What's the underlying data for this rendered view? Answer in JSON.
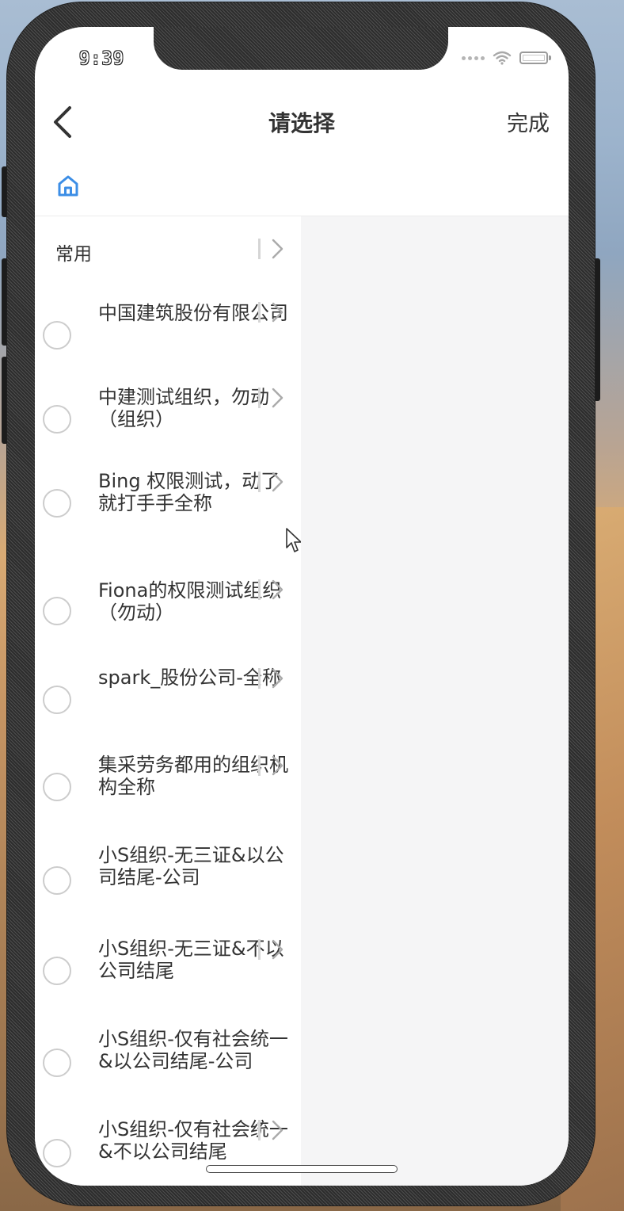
{
  "status_bar": {
    "time": "9:39",
    "icons": [
      "signal-dots-icon",
      "wifi-icon",
      "battery-icon"
    ]
  },
  "navbar": {
    "back_icon": "chevron-left-icon",
    "title": "请选择",
    "done_label": "完成"
  },
  "breadcrumb": {
    "home_icon": "home-icon",
    "accent_color": "#3c8ee6"
  },
  "common": {
    "label": "常用"
  },
  "org_list": [
    {
      "label": "中国建筑股份有限公司",
      "selected": false
    },
    {
      "label": "中建测试组织，勿动（组织）",
      "selected": false
    },
    {
      "label": "Bing 权限测试，动了就打手手全称",
      "selected": false
    },
    {
      "label": "Fiona的权限测试组织（勿动）",
      "selected": false
    },
    {
      "label": "spark_股份公司-全称",
      "selected": false
    },
    {
      "label": "集采劳务都用的组织机构全称",
      "selected": false
    },
    {
      "label": "小S组织-无三证&以公司结尾-公司",
      "selected": false
    },
    {
      "label": "小S组织-无三证&不以公司结尾",
      "selected": false
    },
    {
      "label": "小S组织-仅有社会统一&以公司结尾-公司",
      "selected": false
    },
    {
      "label": "小S组织-仅有社会统一&不以公司结尾",
      "selected": false
    }
  ],
  "colors": {
    "text": "#333333",
    "radio_border": "#cccccc",
    "right_panel_bg": "#f5f5f6",
    "accent": "#3c8ee6"
  }
}
